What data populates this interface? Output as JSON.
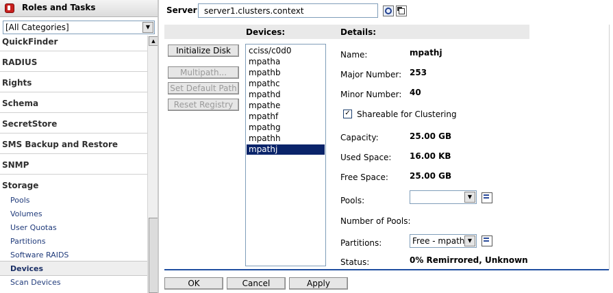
{
  "sidebar": {
    "title": "Roles and Tasks",
    "category_select": "[All Categories]",
    "categories": [
      {
        "label": "QuickFinder"
      },
      {
        "label": "RADIUS"
      },
      {
        "label": "Rights"
      },
      {
        "label": "Schema"
      },
      {
        "label": "SecretStore"
      },
      {
        "label": "SMS Backup and Restore"
      },
      {
        "label": "SNMP"
      },
      {
        "label": "Storage"
      }
    ],
    "storage_items": [
      {
        "label": "Pools"
      },
      {
        "label": "Volumes"
      },
      {
        "label": "User Quotas"
      },
      {
        "label": "Partitions"
      },
      {
        "label": "Software RAIDS"
      },
      {
        "label": "Devices"
      },
      {
        "label": "Scan Devices"
      }
    ],
    "selected_item": "Devices"
  },
  "server": {
    "label": "Server:",
    "value": "server1.clusters.context"
  },
  "headers": {
    "devices": "Devices:",
    "details": "Details:"
  },
  "actions": {
    "initialize": "Initialize Disk",
    "multipath": "Multipath...",
    "set_default_path": "Set Default Path",
    "reset_registry": "Reset Registry"
  },
  "devices": [
    "cciss/c0d0",
    "mpatha",
    "mpathb",
    "mpathc",
    "mpathd",
    "mpathe",
    "mpathf",
    "mpathg",
    "mpathh",
    "mpathj"
  ],
  "selected_device": "mpathj",
  "details": {
    "name_label": "Name:",
    "name": "mpathj",
    "major_label": "Major Number:",
    "major": "253",
    "minor_label": "Minor Number:",
    "minor": "40",
    "shareable_label": "Shareable for Clustering",
    "shareable_checked": true,
    "capacity_label": "Capacity:",
    "capacity": "25.00 GB",
    "used_label": "Used Space:",
    "used": "16.00 KB",
    "free_label": "Free Space:",
    "free": "25.00 GB",
    "pools_label": "Pools:",
    "pools_value": "",
    "num_pools_label": "Number of Pools:",
    "num_pools": "",
    "partitions_label": "Partitions:",
    "partitions_value": "Free - mpathj",
    "status_label": "Status:",
    "status": "0% Remirrored, Unknown"
  },
  "footer": {
    "ok": "OK",
    "cancel": "Cancel",
    "apply": "Apply"
  },
  "colors": {
    "selection": "#0a246a",
    "divider": "#1f4ea0"
  }
}
